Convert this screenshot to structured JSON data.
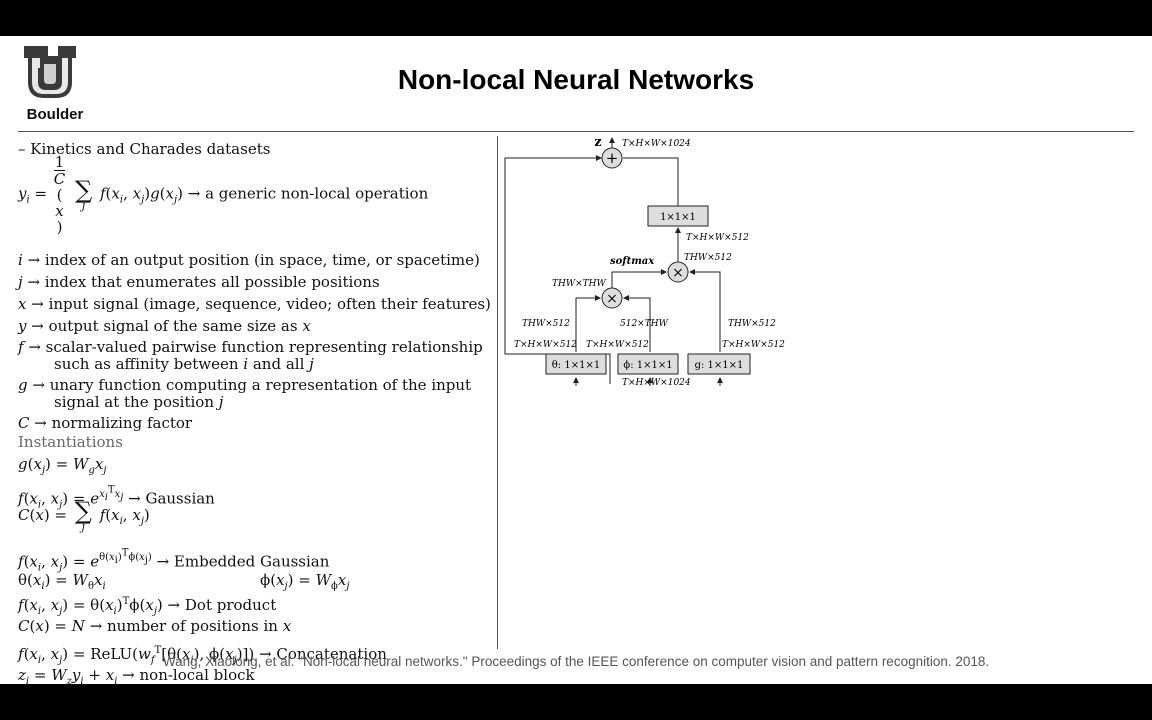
{
  "logo": {
    "text": "Boulder",
    "icon": "cu-logo-icon"
  },
  "title": "Non-local Neural Networks",
  "left": {
    "intro": "– Kinetics and Charades datasets",
    "eq_generic_arrow": "→ a generic non-local operation",
    "defs": {
      "i": "→ index of an output position (in space, time, or spacetime)",
      "j": "→ index that enumerates all possible positions",
      "x": "→ input signal (image, sequence, video; often their features)",
      "y": "→ output signal of the same size as",
      "f1": "→ scalar-valued pairwise function representing relationship",
      "f2": "such as affinity between",
      "f2b": "and all",
      "g1": "→ unary function computing a representation of the input",
      "g2": "signal at the position",
      "c": "→ normalizing factor"
    },
    "instantiations_heading": "Instantiations",
    "gaussian": "→ Gaussian",
    "embedded_gaussian": "→ Embedded Gaussian",
    "dot_product": "→ Dot product",
    "num_positions": "→ number of positions in",
    "relu": "ReLU",
    "concatenation": "→ Concatenation",
    "nonlocal_block": "→ non-local block"
  },
  "diagram": {
    "z_label": "z",
    "plus_symbol": "+",
    "times_symbol": "×",
    "top_dims": "T×H×W×1024",
    "conv_out": "1×1×1",
    "conv_out_dims": "T×H×W×512",
    "softmax": "softmax",
    "thw512_right": "THW×512",
    "thwthw": "THW×THW",
    "thw512_left": "THW×512",
    "thw_512_mid": "512×THW",
    "thw512_g": "THW×512",
    "theta_dims": "T×H×W×512",
    "phi_dims": "T×H×W×512",
    "g_dims": "T×H×W×512",
    "theta_box": "θ: 1×1×1",
    "phi_box": "ϕ: 1×1×1",
    "g_box": "g: 1×1×1",
    "bottom_dims": "T×H×W×1024"
  },
  "citation": "Wang, Xiaolong, et al. \"Non-local neural networks.\" Proceedings of the IEEE conference on computer vision and pattern recognition. 2018."
}
